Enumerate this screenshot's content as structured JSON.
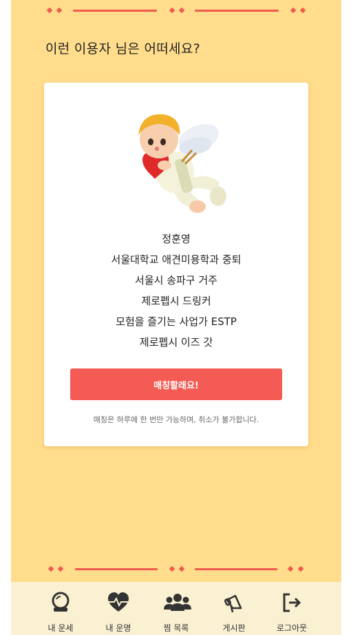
{
  "heading": "이런 이용자 님은 어떠세요?",
  "profile": {
    "name": "정훈영",
    "lines": [
      "서울대학교 애견미용학과 중퇴",
      "서울시 송파구 거주",
      "제로펩시 드링커",
      "모험을 즐기는 사업가 ESTP",
      "제로펩시 이즈 갓"
    ],
    "image_icon": "cupid-illustration"
  },
  "match_button": "매칭할래요!",
  "notice": "매칭은 하루에 한 번만 가능하며, 취소가 불가합니다.",
  "nav": [
    {
      "label": "내 운세",
      "icon": "crystal-ball-icon"
    },
    {
      "label": "내 운명",
      "icon": "heart-pulse-icon"
    },
    {
      "label": "찜 목록",
      "icon": "users-icon"
    },
    {
      "label": "게시판",
      "icon": "megaphone-icon"
    },
    {
      "label": "로그아웃",
      "icon": "logout-icon"
    }
  ],
  "colors": {
    "background": "#ffdd8c",
    "accent": "#f45b54",
    "navbar": "#faf0d2"
  }
}
